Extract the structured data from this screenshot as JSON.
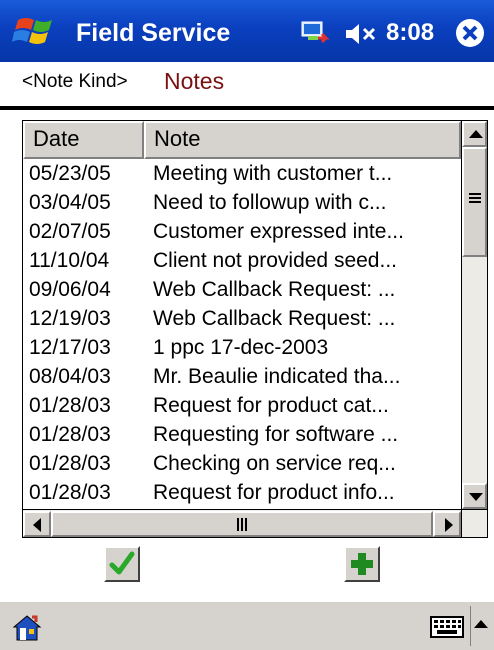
{
  "window": {
    "app_title": "Field Service",
    "clock": "8:08"
  },
  "note_kind": {
    "label": "<Note Kind>",
    "value": "Notes"
  },
  "table": {
    "columns": [
      "Date",
      "Note"
    ],
    "rows": [
      {
        "date": "05/23/05",
        "note": "Meeting with customer t..."
      },
      {
        "date": "03/04/05",
        "note": "Need to followup with c..."
      },
      {
        "date": "02/07/05",
        "note": "Customer expressed inte..."
      },
      {
        "date": "11/10/04",
        "note": "Client not provided seed..."
      },
      {
        "date": "09/06/04",
        "note": "Web Callback Request: ..."
      },
      {
        "date": "12/19/03",
        "note": "Web Callback Request: ..."
      },
      {
        "date": "12/17/03",
        "note": "1 ppc 17-dec-2003"
      },
      {
        "date": "08/04/03",
        "note": "Mr. Beaulie indicated tha..."
      },
      {
        "date": "01/28/03",
        "note": "Request for product cat..."
      },
      {
        "date": "01/28/03",
        "note": "Requesting for software ..."
      },
      {
        "date": "01/28/03",
        "note": "Checking on service req..."
      },
      {
        "date": "01/28/03",
        "note": "Request for product info..."
      }
    ]
  },
  "icons": {
    "start": "windows-flag-icon",
    "connectivity": "connectivity-icon",
    "volume": "speaker-muted-icon",
    "close": "close-icon",
    "ok": "checkmark-icon",
    "add": "plus-icon",
    "home": "home-icon",
    "keyboard": "keyboard-icon"
  },
  "colors": {
    "titlebar": "#0a3fbe",
    "kind_value": "#7a1010",
    "ok_check": "#2aa82a",
    "add_plus": "#1f8a1f"
  }
}
